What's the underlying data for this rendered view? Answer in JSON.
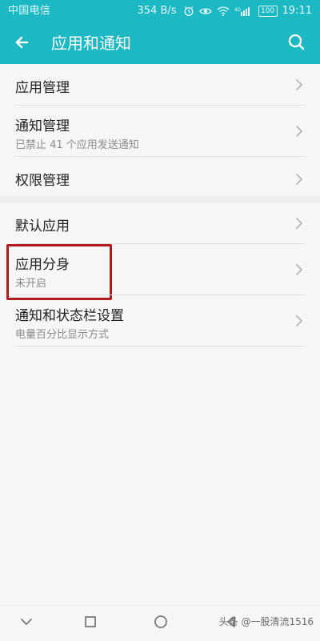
{
  "status_bar": {
    "carrier": "中国电信",
    "speed": "354 B/s",
    "network_label": "4G",
    "battery": "100",
    "time": "19:11"
  },
  "header": {
    "title": "应用和通知"
  },
  "group1": {
    "items": [
      {
        "label": "应用管理"
      },
      {
        "label": "通知管理",
        "sub": "已禁止 41 个应用发送通知"
      },
      {
        "label": "权限管理"
      }
    ]
  },
  "group2": {
    "items": [
      {
        "label": "默认应用"
      },
      {
        "label": "应用分身",
        "sub": "未开启"
      },
      {
        "label": "通知和状态栏设置",
        "sub": "电量百分比显示方式"
      }
    ]
  },
  "watermark": "头条 @一股清流1516",
  "colors": {
    "accent": "#1cb8c4",
    "highlight": "#b11a1a",
    "text_primary": "#1f1f1f",
    "text_secondary": "#8b8b8b",
    "background": "#f6f6f6"
  },
  "icons": {
    "back": "arrow-left-icon",
    "search": "search-icon",
    "chevron": "chevron-right-icon",
    "nav_down": "chevron-down-icon",
    "nav_recent": "square-icon",
    "nav_home": "circle-icon",
    "nav_back": "triangle-left-icon"
  }
}
